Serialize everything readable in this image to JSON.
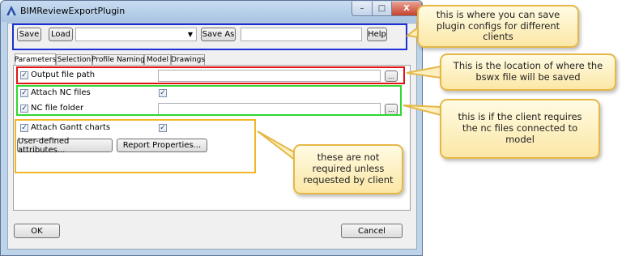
{
  "window": {
    "title": "BIMReviewExportPlugin",
    "minimize_glyph": "–",
    "maximize_glyph": "□",
    "close_glyph": "X"
  },
  "toolbar": {
    "save_label": "Save",
    "load_label": "Load",
    "config_value": "",
    "save_as_label": "Save As",
    "save_as_value": "",
    "help_label": "Help"
  },
  "tabs": [
    {
      "label": "Parameters",
      "active": true
    },
    {
      "label": "Selection",
      "active": false
    },
    {
      "label": "Profile Naming",
      "active": false
    },
    {
      "label": "Model",
      "active": false
    },
    {
      "label": "Drawings",
      "active": false
    }
  ],
  "parameters": {
    "output_file_path": {
      "label": "Output file path",
      "checked": true,
      "value": "",
      "browse_label": "..."
    },
    "attach_nc_files": {
      "label": "Attach NC files",
      "checked": true,
      "right_checked": true
    },
    "nc_file_folder": {
      "label": "NC file folder",
      "checked": true,
      "value": "",
      "browse_label": "..."
    },
    "attach_gantt_charts": {
      "label": "Attach Gantt charts",
      "checked": true,
      "right_checked": true
    },
    "user_defined_attributes_label": "User-defined attributes...",
    "report_properties_label": "Report Properties..."
  },
  "footer": {
    "ok_label": "OK",
    "cancel_label": "Cancel"
  },
  "callouts": {
    "configs": "this is where you can save plugin configs for different clients",
    "bswx": "This is the location of where the bswx file will be saved",
    "nc": "this is if the client requires the nc files connected to model",
    "optional": "these are not required unless requested by client"
  },
  "colors": {
    "blue_box": "#1a2fd6",
    "red_box": "#e01414",
    "green_box": "#2ed82e",
    "yellow_box": "#f0b829",
    "callout_border": "#e6b746"
  },
  "icons": {
    "app": "bim-logo-icon",
    "check": "✓",
    "dropdown": "▼"
  }
}
